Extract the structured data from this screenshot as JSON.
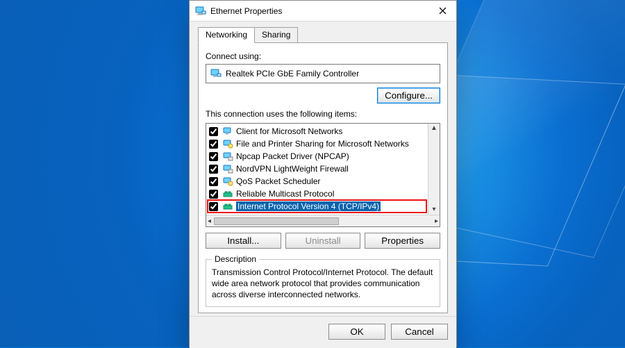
{
  "title": "Ethernet Properties",
  "tabs": {
    "networking": "Networking",
    "sharing": "Sharing"
  },
  "connect_using_label": "Connect using:",
  "adapter_name": "Realtek PCIe GbE Family Controller",
  "configure_btn": "Configure...",
  "items_label": "This connection uses the following items:",
  "items": [
    {
      "label": "Client for Microsoft Networks",
      "checked": true,
      "icon": "client"
    },
    {
      "label": "File and Printer Sharing for Microsoft Networks",
      "checked": true,
      "icon": "service"
    },
    {
      "label": "Npcap Packet Driver (NPCAP)",
      "checked": true,
      "icon": "driver"
    },
    {
      "label": "NordVPN LightWeight Firewall",
      "checked": true,
      "icon": "driver"
    },
    {
      "label": "QoS Packet Scheduler",
      "checked": true,
      "icon": "service"
    },
    {
      "label": "Reliable Multicast Protocol",
      "checked": true,
      "icon": "protocol"
    },
    {
      "label": "Internet Protocol Version 4 (TCP/IPv4)",
      "checked": true,
      "icon": "protocol",
      "selected": true,
      "highlight": true
    }
  ],
  "install_btn": "Install...",
  "uninstall_btn": "Uninstall",
  "properties_btn": "Properties",
  "description_heading": "Description",
  "description_text": "Transmission Control Protocol/Internet Protocol. The default wide area network protocol that provides communication across diverse interconnected networks.",
  "ok_btn": "OK",
  "cancel_btn": "Cancel"
}
